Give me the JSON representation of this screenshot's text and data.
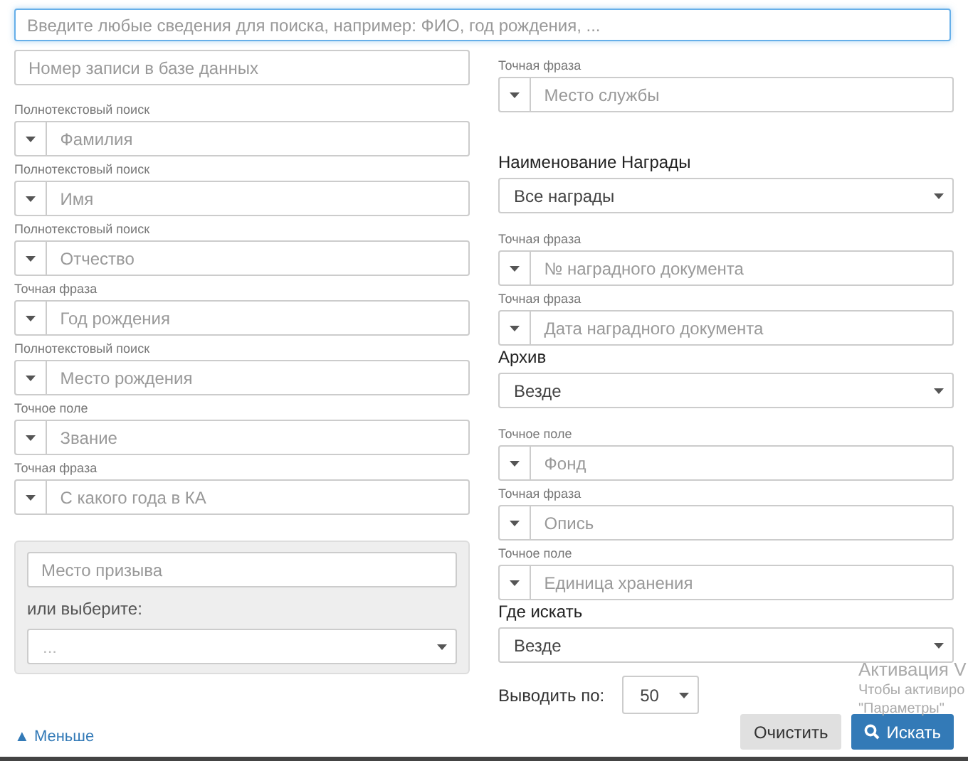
{
  "main_search": {
    "placeholder": "Введите любые сведения для поиска, например: ФИО, год рождения, ..."
  },
  "left": {
    "record_field": {
      "placeholder": "Номер записи в базе данных"
    },
    "fields": [
      {
        "label": "Полнотекстовый поиск",
        "placeholder": "Фамилия"
      },
      {
        "label": "Полнотекстовый поиск",
        "placeholder": "Имя"
      },
      {
        "label": "Полнотекстовый поиск",
        "placeholder": "Отчество"
      },
      {
        "label": "Точная фраза",
        "placeholder": "Год рождения"
      },
      {
        "label": "Полнотекстовый поиск",
        "placeholder": "Место рождения"
      },
      {
        "label": "Точное поле",
        "placeholder": "Звание"
      },
      {
        "label": "Точная фраза",
        "placeholder": "С какого года в КА"
      }
    ],
    "conscription": {
      "placeholder": "Место призыва",
      "or_label": "или выберите:",
      "select_value": "..."
    },
    "toggle_link": "▲ Меньше"
  },
  "right": [
    {
      "kind": "field",
      "label": "Точная фраза",
      "placeholder": "Место службы"
    },
    {
      "kind": "select",
      "heading": "Наименование Награды",
      "value": "Все награды"
    },
    {
      "kind": "field",
      "label": "Точная фраза",
      "placeholder": "№ наградного документа"
    },
    {
      "kind": "field",
      "label": "Точная фраза",
      "placeholder": "Дата наградного документа"
    },
    {
      "kind": "select",
      "heading": "Архив",
      "value": "Везде"
    },
    {
      "kind": "field",
      "label": "Точное поле",
      "placeholder": "Фонд"
    },
    {
      "kind": "field",
      "label": "Точная фраза",
      "placeholder": "Опись"
    },
    {
      "kind": "field",
      "label": "Точное поле",
      "placeholder": "Единица хранения"
    },
    {
      "kind": "select",
      "heading": "Где искать",
      "value": "Везде"
    }
  ],
  "per_page": {
    "label": "Выводить по:",
    "value": "50"
  },
  "buttons": [
    {
      "kind": "secondary",
      "label": "Очистить"
    },
    {
      "kind": "primary",
      "label": "Искать"
    }
  ],
  "os_notice": [
    "Активация V",
    "Чтобы активиро",
    "\"Параметры\""
  ]
}
